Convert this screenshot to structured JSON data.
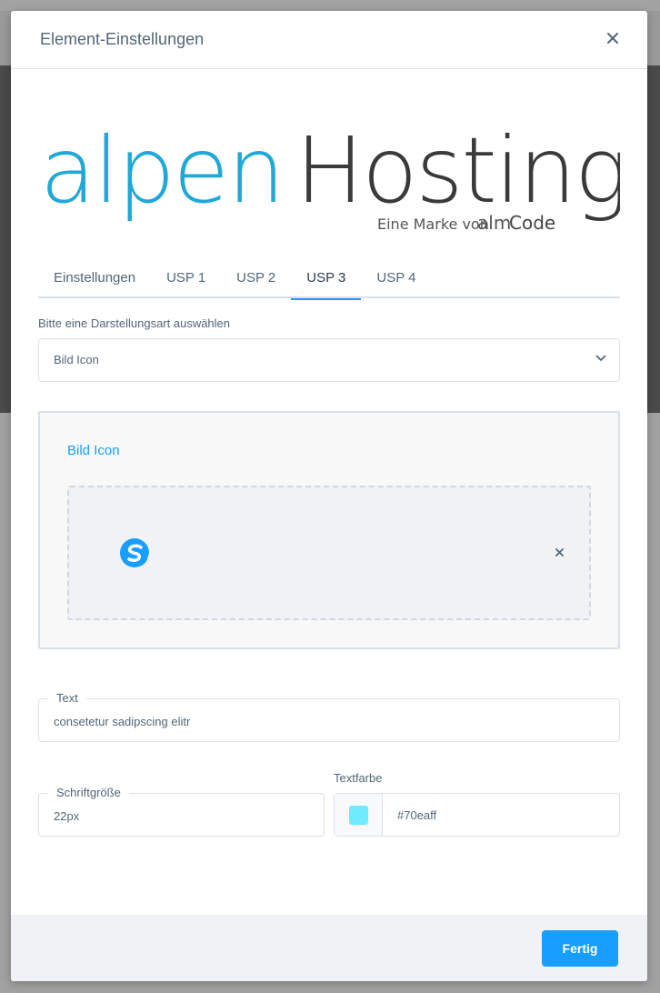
{
  "modal": {
    "title": "Element-Einstellungen"
  },
  "logo": {
    "part1": "alpen",
    "part2": "Hosting",
    "tagline_prefix": "Eine Marke von",
    "tagline_brand_a": "alm",
    "tagline_brand_b": "Code",
    "color_primary": "#1fa8d9",
    "color_secondary": "#3a3a3a"
  },
  "tabs": [
    {
      "label": "Einstellungen",
      "active": false
    },
    {
      "label": "USP 1",
      "active": false
    },
    {
      "label": "USP 2",
      "active": false
    },
    {
      "label": "USP 3",
      "active": true
    },
    {
      "label": "USP 4",
      "active": false
    }
  ],
  "display_type": {
    "label": "Bitte eine Darstellungsart auswählen",
    "value": "Bild Icon"
  },
  "icon_panel": {
    "title": "Bild Icon",
    "icon_name": "shopware-logo-icon"
  },
  "text_field": {
    "label": "Text",
    "value": "consetetur sadipscing elitr"
  },
  "font_size_field": {
    "label": "Schriftgröße",
    "value": "22px"
  },
  "color_field": {
    "label": "Textfarbe",
    "value": "#70eaff"
  },
  "footer": {
    "done_label": "Fertig"
  },
  "colors": {
    "accent": "#189eff",
    "swatch": "#70eaff"
  }
}
